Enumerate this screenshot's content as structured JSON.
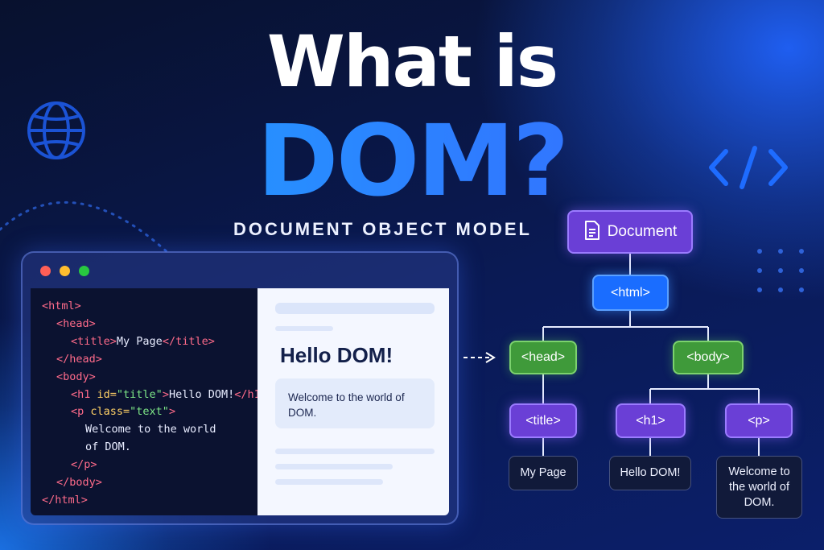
{
  "title": {
    "line1": "What is",
    "line2": "DOM?",
    "subtitle": "DOCUMENT OBJECT MODEL"
  },
  "code_lines": [
    {
      "indent": 0,
      "parts": [
        {
          "t": "<html>",
          "c": "tag"
        }
      ]
    },
    {
      "indent": 1,
      "parts": [
        {
          "t": "<head>",
          "c": "tag"
        }
      ]
    },
    {
      "indent": 2,
      "parts": [
        {
          "t": "<title>",
          "c": "tag"
        },
        {
          "t": "My Page",
          "c": "txt"
        },
        {
          "t": "</title>",
          "c": "tag"
        }
      ]
    },
    {
      "indent": 1,
      "parts": [
        {
          "t": "</head>",
          "c": "tag"
        }
      ]
    },
    {
      "indent": 1,
      "parts": [
        {
          "t": "<body>",
          "c": "tag"
        }
      ]
    },
    {
      "indent": 2,
      "parts": [
        {
          "t": "<h1 ",
          "c": "tag"
        },
        {
          "t": "id=",
          "c": "attr"
        },
        {
          "t": "\"title\"",
          "c": "str"
        },
        {
          "t": ">",
          "c": "tag"
        },
        {
          "t": "Hello DOM!",
          "c": "txt"
        },
        {
          "t": "</h1>",
          "c": "tag"
        }
      ]
    },
    {
      "indent": 2,
      "parts": [
        {
          "t": "<p ",
          "c": "tag"
        },
        {
          "t": "class=",
          "c": "attr"
        },
        {
          "t": "\"text\"",
          "c": "str"
        },
        {
          "t": ">",
          "c": "tag"
        }
      ]
    },
    {
      "indent": 3,
      "parts": [
        {
          "t": "Welcome to the world",
          "c": "txt"
        }
      ]
    },
    {
      "indent": 3,
      "parts": [
        {
          "t": "of DOM.",
          "c": "txt"
        }
      ]
    },
    {
      "indent": 2,
      "parts": [
        {
          "t": "</p>",
          "c": "tag"
        }
      ]
    },
    {
      "indent": 1,
      "parts": [
        {
          "t": "</body>",
          "c": "tag"
        }
      ]
    },
    {
      "indent": 0,
      "parts": [
        {
          "t": "</html>",
          "c": "tag"
        }
      ]
    }
  ],
  "preview": {
    "heading": "Hello DOM!",
    "paragraph": "Welcome to the world of DOM."
  },
  "tree": {
    "document": "Document",
    "html": "<html>",
    "head": "<head>",
    "body": "<body>",
    "title": "<title>",
    "h1": "<h1>",
    "p": "<p>",
    "title_text": "My Page",
    "h1_text": "Hello DOM!",
    "p_text": "Welcome to the world of DOM."
  },
  "colors": {
    "accent": "#1ea6ff",
    "tag": "#ff6b8a",
    "attr": "#ffd166",
    "string": "#7ee787",
    "node_purple": "#6a3fd6",
    "node_blue": "#1a6dff",
    "node_green": "#3f9a3a"
  }
}
